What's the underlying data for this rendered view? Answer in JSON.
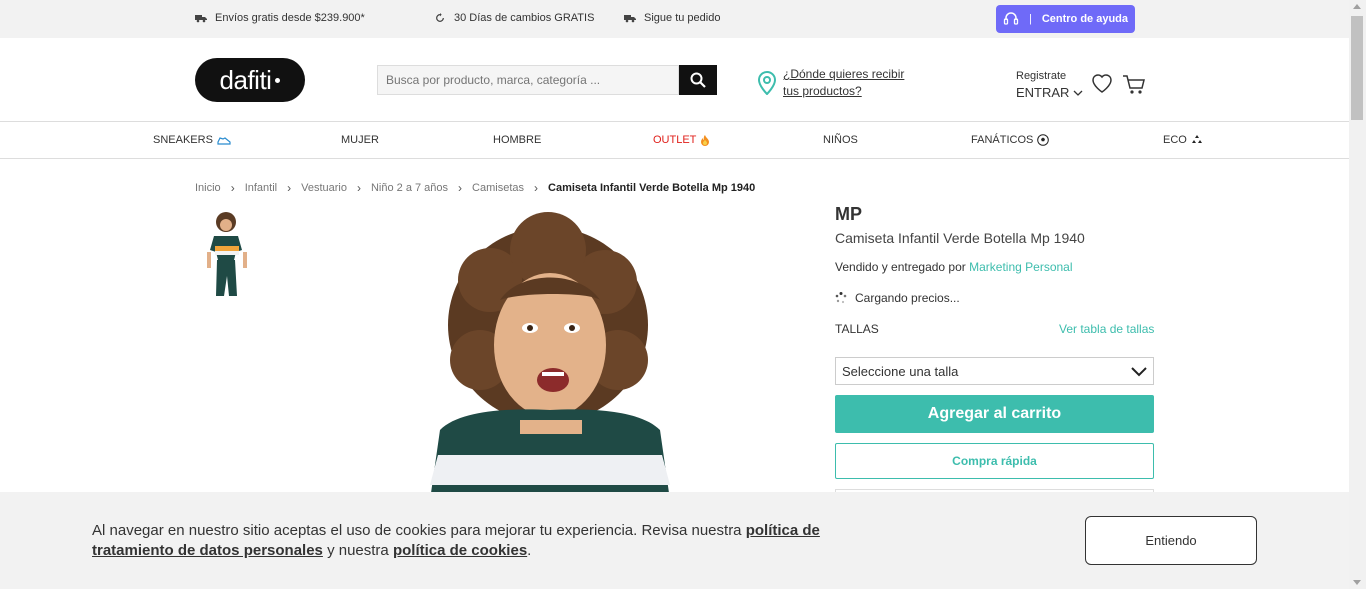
{
  "topbar": {
    "shipping": "Envíos gratis desde $239.900*",
    "returns": "30 Días de cambios GRATIS",
    "track": "Sigue tu pedido",
    "help_separator": "|",
    "help": "Centro de ayuda"
  },
  "header": {
    "logo": "dafiti",
    "search_placeholder": "Busca por producto, marca, categoría ...",
    "location_text": "¿Dónde quieres recibir tus productos?",
    "register": "Registrate",
    "login": "ENTRAR"
  },
  "nav": {
    "items": [
      {
        "label": "SNEAKERS"
      },
      {
        "label": "MUJER"
      },
      {
        "label": "HOMBRE"
      },
      {
        "label": "OUTLET"
      },
      {
        "label": "NIÑOS"
      },
      {
        "label": "FANÁTICOS"
      },
      {
        "label": "ECO"
      }
    ]
  },
  "breadcrumb": [
    "Inicio",
    "Infantil",
    "Vestuario",
    "Niño 2 a 7 años",
    "Camisetas",
    "Camiseta Infantil Verde Botella Mp 1940"
  ],
  "product": {
    "brand": "MP",
    "name": "Camiseta Infantil Verde Botella Mp 1940",
    "seller_prefix": "Vendido y entregado por",
    "seller": "Marketing Personal",
    "loading": "Cargando precios...",
    "sizes_label": "TALLAS",
    "size_chart": "Ver tabla de tallas",
    "size_select": "Seleccione una talla",
    "add_to_cart": "Agregar al carrito",
    "quick_buy": "Compra rápida"
  },
  "cookie": {
    "text_1": "Al navegar en nuestro sitio aceptas el uso de cookies para mejorar tu experiencia. Revisa nuestra ",
    "link_1": "política de tratamiento de datos personales",
    "text_2": " y nuestra ",
    "link_2": "política de cookies",
    "text_3": ".",
    "accept": "Entiendo"
  },
  "colors": {
    "accent": "#3dbdad",
    "help": "#6f6af8",
    "outlet": "#e0201b"
  }
}
